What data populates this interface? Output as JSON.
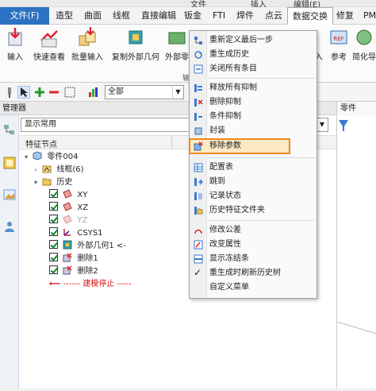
{
  "top_strip": {
    "fragments": [
      "文件",
      "插入",
      "编辑(E)"
    ]
  },
  "menubar": {
    "items": [
      {
        "label": "文件(F)"
      },
      {
        "label": "造型"
      },
      {
        "label": "曲面"
      },
      {
        "label": "线框"
      },
      {
        "label": "直接编辑"
      },
      {
        "label": "钣金"
      },
      {
        "label": "FTI"
      },
      {
        "label": "焊件"
      },
      {
        "label": "点云"
      },
      {
        "label": "数据交换"
      },
      {
        "label": "修复"
      },
      {
        "label": "PM"
      }
    ]
  },
  "ribbon": {
    "buttons": [
      {
        "label": "输入"
      },
      {
        "label": "快速查看"
      },
      {
        "label": "批量输入"
      },
      {
        "label": "复制外部几何"
      },
      {
        "label": "外部零"
      },
      {
        "label": "入"
      },
      {
        "label": "参考"
      },
      {
        "label": "简化导"
      }
    ],
    "group_label": "输"
  },
  "toolbar": {
    "combo_value": "全部"
  },
  "panel": {
    "title": "管理器",
    "right_tab": "零件"
  },
  "manager": {
    "filter_value": "显示常用",
    "column_header": "特征节点",
    "tree": [
      {
        "label": "零件004"
      },
      {
        "label": "线框(6)"
      },
      {
        "label": "历史"
      },
      {
        "label": "XY"
      },
      {
        "label": "XZ"
      },
      {
        "label": "YZ"
      },
      {
        "label": "CSYS1"
      },
      {
        "label": "外部几何1 <-"
      },
      {
        "label": "删除1"
      },
      {
        "label": "删除2"
      },
      {
        "label": "------ 建模停止 -----"
      }
    ]
  },
  "context_menu": {
    "items": [
      {
        "label": "重新定义最后一步"
      },
      {
        "label": "重生成历史"
      },
      {
        "label": "关闭所有条目"
      },
      {
        "label": "释放所有抑制"
      },
      {
        "label": "删除抑制"
      },
      {
        "label": "条件抑制"
      },
      {
        "label": "封装"
      },
      {
        "label": "移除参数"
      },
      {
        "label": "配置表"
      },
      {
        "label": "跳到"
      },
      {
        "label": "记录状态"
      },
      {
        "label": "历史特征文件夹"
      },
      {
        "label": "修改公差"
      },
      {
        "label": "改变属性"
      },
      {
        "label": "显示冻结条"
      },
      {
        "label": "重生成时刷新历史树"
      },
      {
        "label": "自定义菜单"
      }
    ],
    "highlighted": "移除参数"
  },
  "colors": {
    "accent": "#2b73c2",
    "highlight_border": "#e98a1c",
    "highlight_fill": "#fde9c4",
    "stop_red": "#d11111"
  }
}
